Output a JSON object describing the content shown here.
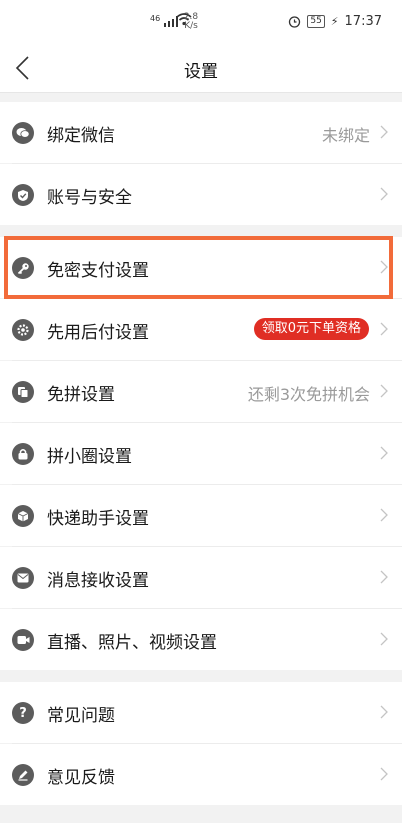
{
  "status_bar": {
    "network": "46",
    "speed_value": "2.8",
    "speed_unit": "K/s",
    "battery": "55",
    "time": "17:37"
  },
  "nav": {
    "title": "设置"
  },
  "rows": [
    {
      "label": "绑定微信",
      "value": "未绑定",
      "icon": "wechat-icon"
    },
    {
      "label": "账号与安全",
      "value": "",
      "icon": "shield-icon"
    },
    {
      "label": "免密支付设置",
      "value": "",
      "icon": "key-icon"
    },
    {
      "label": "先用后付设置",
      "badge": "领取0元下单资格",
      "icon": "gear-badge-icon"
    },
    {
      "label": "免拼设置",
      "value": "还剩3次免拼机会",
      "icon": "copy-icon"
    },
    {
      "label": "拼小圈设置",
      "value": "",
      "icon": "lock-icon"
    },
    {
      "label": "快递助手设置",
      "value": "",
      "icon": "box-icon"
    },
    {
      "label": "消息接收设置",
      "value": "",
      "icon": "mail-icon"
    },
    {
      "label": "直播、照片、视频设置",
      "value": "",
      "icon": "video-icon"
    },
    {
      "label": "常见问题",
      "value": "",
      "icon": "question-icon"
    },
    {
      "label": "意见反馈",
      "value": "",
      "icon": "pen-icon"
    }
  ],
  "colors": {
    "accent_red": "#e02e24",
    "highlight_orange": "#f26b3a"
  }
}
